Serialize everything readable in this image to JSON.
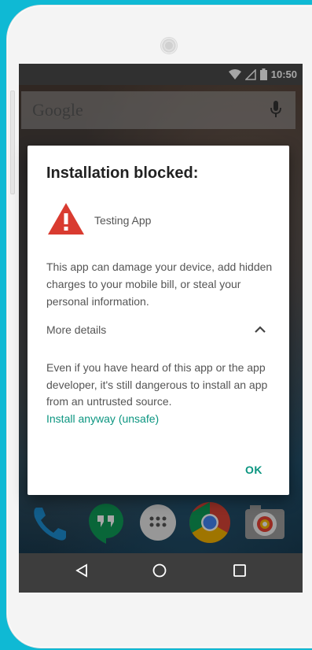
{
  "status_bar": {
    "time": "10:50",
    "icons": [
      "wifi-icon",
      "signal-icon",
      "battery-icon"
    ]
  },
  "search": {
    "logo_text": "Google",
    "icon": "mic-icon"
  },
  "dock": {
    "apps": [
      "phone-app",
      "hangouts-app",
      "app-drawer",
      "chrome-app",
      "camera-app"
    ]
  },
  "dialog": {
    "title": "Installation blocked:",
    "app_name": "Testing App",
    "warning_text": "This app can damage your device, add hidden charges to your mobile bill, or steal your personal information.",
    "more_details_label": "More details",
    "details_text": "Even if you have heard of this app or the app developer, it's still dangerous to install an app from an untrusted source.",
    "install_link": "Install anyway (unsafe)",
    "ok_label": "OK"
  },
  "nav": {
    "buttons": [
      "back-button",
      "home-button",
      "recents-button"
    ]
  },
  "colors": {
    "accent": "#0b9580",
    "warning_red": "#d93b30",
    "frame_bg": "#0fb9d4"
  }
}
